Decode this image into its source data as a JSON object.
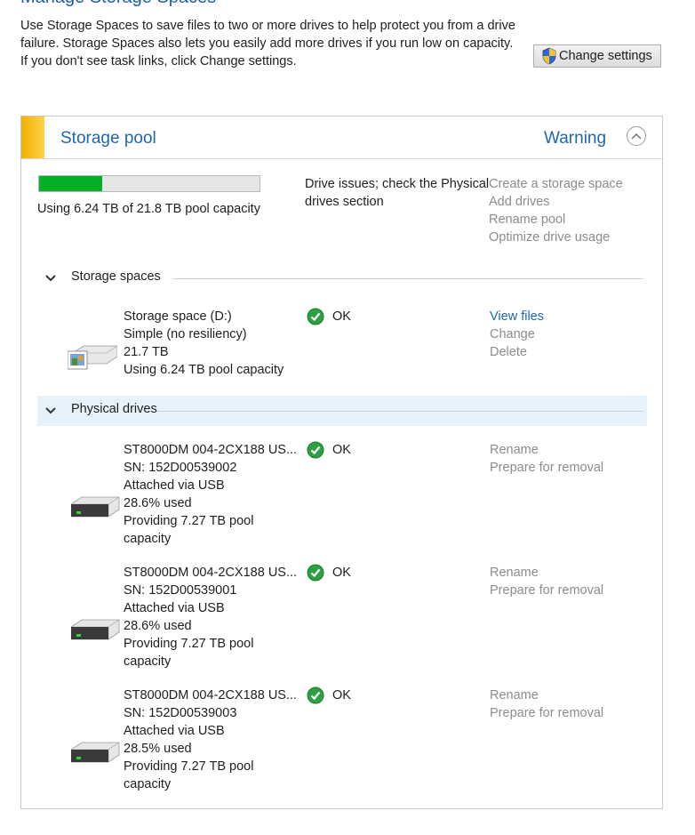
{
  "header": {
    "title": "Manage Storage Spaces",
    "description": "Use Storage Spaces to save files to two or more drives to help protect you from a drive failure. Storage Spaces also lets you easily add more drives if you run low on capacity. If you don't see task links, click Change settings.",
    "change_settings_label": "Change settings"
  },
  "pool": {
    "title": "Storage pool",
    "status": "Warning",
    "usage_text": "Using 6.24 TB of 21.8 TB pool capacity",
    "usage_fraction": 0.286,
    "issue_line1": "Drive issues; check the Physical",
    "issue_line2": "drives section",
    "actions": [
      "Create a storage space",
      "Add drives",
      "Rename pool",
      "Optimize drive usage"
    ]
  },
  "storage_spaces": {
    "label": "Storage spaces",
    "items": [
      {
        "name": "Storage space (D:)",
        "resiliency": "Simple (no resiliency)",
        "size": "21.7 TB",
        "usage": "Using 6.24 TB pool capacity",
        "status": "OK",
        "actions": [
          "View files",
          "Change",
          "Delete"
        ]
      }
    ]
  },
  "physical_drives": {
    "label": "Physical drives",
    "items": [
      {
        "name": "ST8000DM 004-2CX188 US...",
        "serial": "SN: 152D00539002",
        "connection": "Attached via USB",
        "used": "28.6% used",
        "providing1": "Providing 7.27 TB pool",
        "providing2": "capacity",
        "status": "OK",
        "actions": [
          "Rename",
          "Prepare for removal"
        ]
      },
      {
        "name": "ST8000DM 004-2CX188 US...",
        "serial": "SN: 152D00539001",
        "connection": "Attached via USB",
        "used": "28.6% used",
        "providing1": "Providing 7.27 TB pool",
        "providing2": "capacity",
        "status": "OK",
        "actions": [
          "Rename",
          "Prepare for removal"
        ]
      },
      {
        "name": "ST8000DM 004-2CX188 US...",
        "serial": "SN: 152D00539003",
        "connection": "Attached via USB",
        "used": "28.5% used",
        "providing1": "Providing 7.27 TB pool",
        "providing2": "capacity",
        "status": "OK",
        "actions": [
          "Rename",
          "Prepare for removal"
        ]
      }
    ]
  },
  "colors": {
    "accent_link": "#1e66b0",
    "warning_stripe": "#f0b000",
    "progress_fill": "#06b025",
    "section_highlight": "#e5f1fb",
    "ok_green": "#2ea043"
  },
  "icons": [
    "shield-icon",
    "collapse-chevron-up-icon",
    "chevron-down-icon",
    "ok-check-icon",
    "storage-space-drive-icon",
    "hard-drive-icon"
  ]
}
